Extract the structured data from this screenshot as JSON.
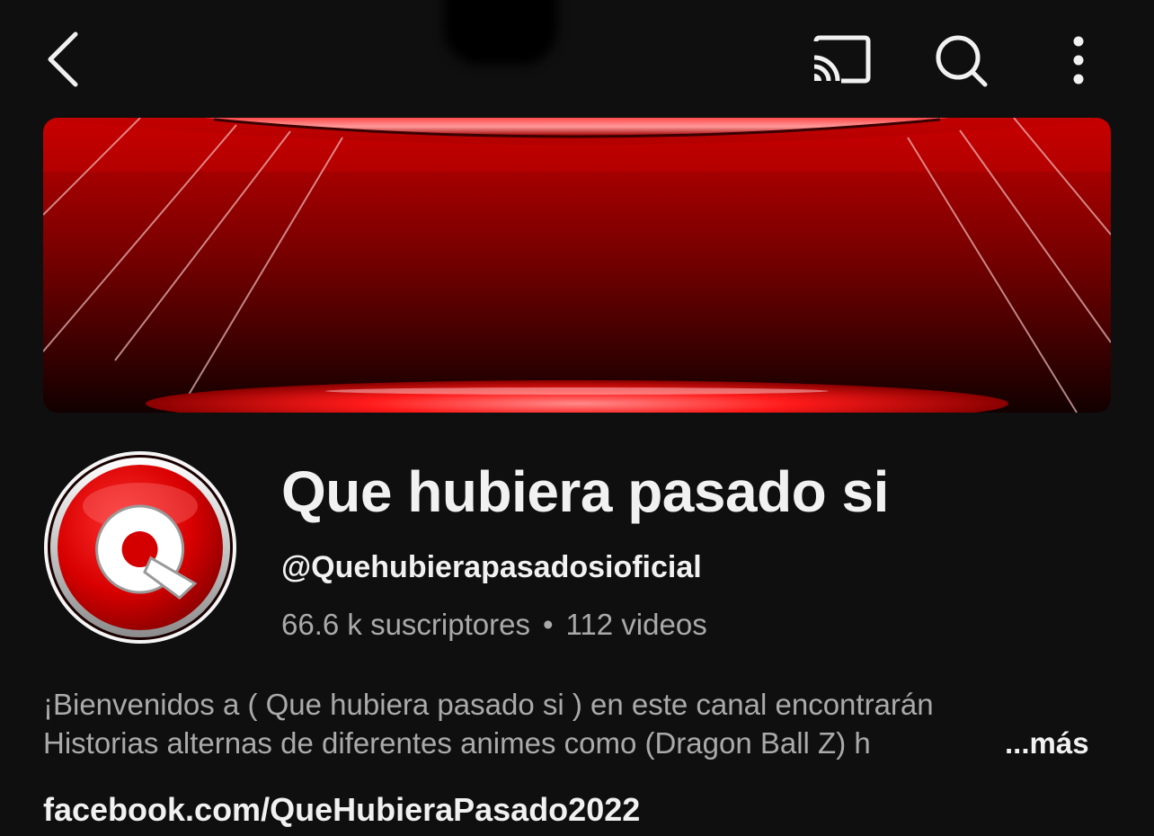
{
  "header": {
    "icons": [
      "back-arrow-icon",
      "cast-icon",
      "search-icon",
      "more-vertical-icon"
    ]
  },
  "channel": {
    "name": "Que hubiera pasado si",
    "handle": "@Quehubierapasadosioficial",
    "subscribers": "66.6 k suscriptores",
    "separator": "•",
    "videos": "112 videos",
    "avatar_letter": "Q",
    "description_line1": "¡Bienvenidos a ( Que hubiera pasado si ) en este canal encontrarán",
    "description_line2": "Historias alternas de diferentes animes como (Dragon Ball Z) h",
    "more_label": "...más",
    "link": "facebook.com/QueHubieraPasado2022"
  },
  "colors": {
    "background": "#0f0f0f",
    "text_primary": "#f1f1f1",
    "text_secondary": "#aaaaaa",
    "brand_red": "#d40000"
  }
}
